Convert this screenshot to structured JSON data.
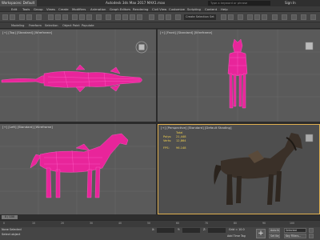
{
  "titlebar": {
    "workspace": "Workspaces: Default",
    "app_title": "Autodesk 3ds Max 2017      MAX1.max",
    "search_placeholder": "Type a keyword or phrase",
    "signin": "Sign In"
  },
  "menu": [
    "Edit",
    "Tools",
    "Group",
    "Views",
    "Create",
    "Modifiers",
    "Animation",
    "Graph Editors",
    "Rendering",
    "Civil View",
    "Customize",
    "Scripting",
    "Content",
    "Help"
  ],
  "toolbar": {
    "selection_set": "Create Selection Set"
  },
  "ribbon": [
    "Modeling",
    "Freeform",
    "Selection",
    "Object Paint",
    "Populate"
  ],
  "viewports": {
    "top": "[+] [Top] [Standard] [Wireframe]",
    "front": "[+] [Front] [Standard] [Wireframe]",
    "left": "[+] [Left] [Standard] [Wireframe]",
    "perspective": "[+] [Perspective] [Standard] [Default Shading]"
  },
  "stats": {
    "header": "Total",
    "polys_label": "Polys:",
    "polys": "21,448",
    "verts_label": "Verts:",
    "verts": "12,864",
    "fps_label": "FPS:",
    "fps": "96.148"
  },
  "timeline": {
    "slider": "0 / 100",
    "ticks": [
      "0",
      "10",
      "20",
      "30",
      "40",
      "50",
      "60",
      "70",
      "80",
      "90",
      "100"
    ]
  },
  "status": {
    "message": "None Selected",
    "prompt": "Select object",
    "x_label": "X:",
    "y_label": "Y:",
    "z_label": "Z:",
    "grid": "Grid = 10.0",
    "add_time_tag": "Add Time Tag",
    "auto_key": "Auto Key",
    "set_key": "Set Key",
    "selected": "Selected",
    "key_filters": "Key Filters..."
  },
  "colors": {
    "wireframe": "#ff2fae",
    "horse_shaded": "#3a3028",
    "viewport_bg": "#5a5a5a",
    "active_border": "#e0b050",
    "stats_text": "#f0d050"
  }
}
